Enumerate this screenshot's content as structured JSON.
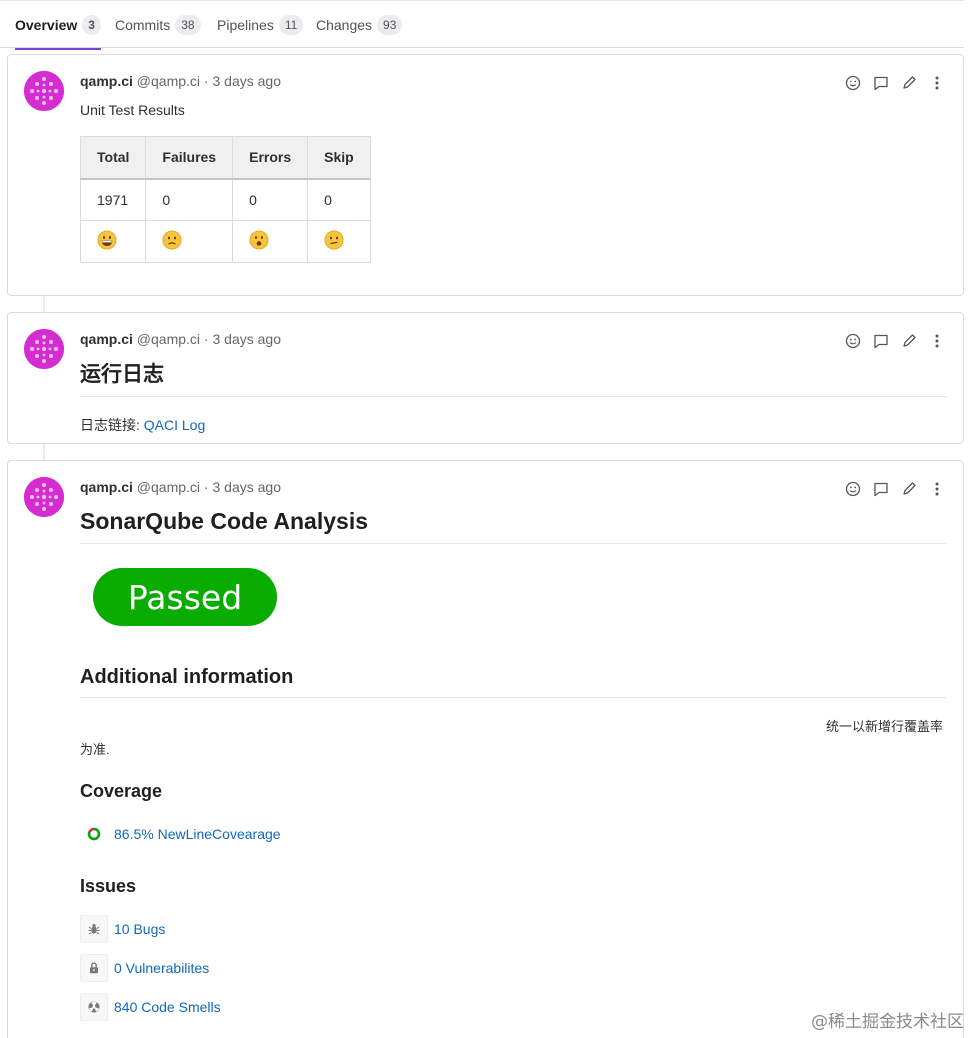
{
  "tabs": [
    {
      "label": "Overview",
      "count": "3"
    },
    {
      "label": "Commits",
      "count": "38"
    },
    {
      "label": "Pipelines",
      "count": "11"
    },
    {
      "label": "Changes",
      "count": "93"
    }
  ],
  "author": {
    "name": "qamp.ci",
    "handle": "@qamp.ci",
    "separator": "·",
    "time": "3 days ago"
  },
  "colors": {
    "accent": "#6e49cb",
    "link": "#1068bf",
    "passed": "#09ad00",
    "avatar": "#d52cd2"
  },
  "notes": [
    {
      "title": "Unit Test Results",
      "table": {
        "headers": [
          "Total",
          "Failures",
          "Errors",
          "Skip"
        ],
        "values": [
          "1971",
          "0",
          "0",
          "0"
        ],
        "emojis": [
          "grinning-face",
          "slightly-frowning-face",
          "frowning-open-mouth-face",
          "confused-face"
        ]
      }
    },
    {
      "title": "运行日志",
      "log_label": "日志链接: ",
      "log_link": "QACI Log"
    },
    {
      "title": "SonarQube Code Analysis",
      "status": "Passed",
      "additional_heading": "Additional information",
      "additional_text_right": "统一以新增行覆盖率",
      "additional_text_left": "为准.",
      "coverage_heading": "Coverage",
      "coverage_link": "86.5% NewLineCovearage",
      "issues_heading": "Issues",
      "issues": [
        {
          "icon": "bug-icon",
          "label": "10 Bugs"
        },
        {
          "icon": "lock-icon",
          "label": "0 Vulnerabilites"
        },
        {
          "icon": "radiation-icon",
          "label": "840 Code Smells"
        }
      ]
    }
  ],
  "watermark": "@稀土掘金技术社区"
}
